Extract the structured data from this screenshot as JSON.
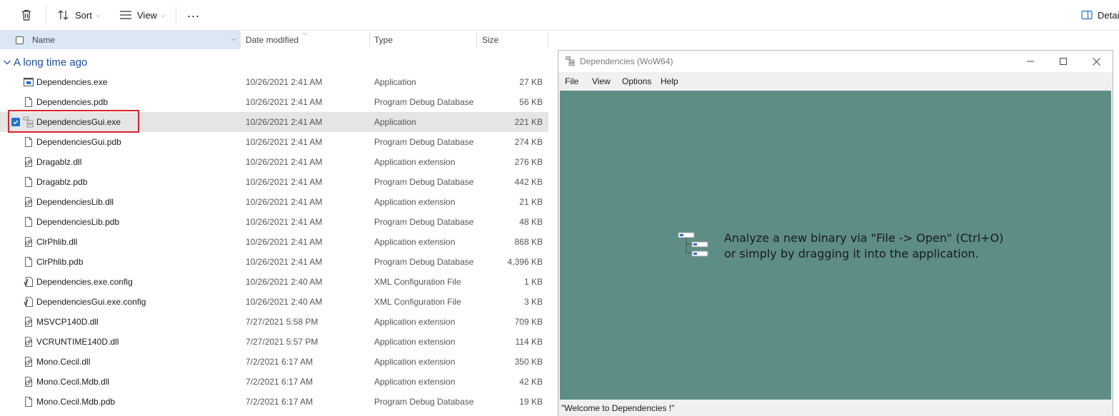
{
  "toolbar": {
    "delete_icon": "trash-icon",
    "sort_label": "Sort",
    "view_label": "View",
    "more_label": "...",
    "details_label": "Detai"
  },
  "columns": {
    "name": "Name",
    "date": "Date modified",
    "type": "Type",
    "size": "Size"
  },
  "group": {
    "label": "A long time ago"
  },
  "files": [
    {
      "name": "Dependencies.exe",
      "date": "10/26/2021 2:41 AM",
      "type": "Application",
      "size": "27 KB",
      "icon": "exe-icon"
    },
    {
      "name": "Dependencies.pdb",
      "date": "10/26/2021 2:41 AM",
      "type": "Program Debug Database",
      "size": "56 KB",
      "icon": "file-icon"
    },
    {
      "name": "DependenciesGui.exe",
      "date": "10/26/2021 2:41 AM",
      "type": "Application",
      "size": "221 KB",
      "icon": "app-icon",
      "selected": true
    },
    {
      "name": "DependenciesGui.pdb",
      "date": "10/26/2021 2:41 AM",
      "type": "Program Debug Database",
      "size": "274 KB",
      "icon": "file-icon"
    },
    {
      "name": "Dragablz.dll",
      "date": "10/26/2021 2:41 AM",
      "type": "Application extension",
      "size": "276 KB",
      "icon": "dll-icon"
    },
    {
      "name": "Dragablz.pdb",
      "date": "10/26/2021 2:41 AM",
      "type": "Program Debug Database",
      "size": "442 KB",
      "icon": "file-icon"
    },
    {
      "name": "DependenciesLib.dll",
      "date": "10/26/2021 2:41 AM",
      "type": "Application extension",
      "size": "21 KB",
      "icon": "dll-icon"
    },
    {
      "name": "DependenciesLib.pdb",
      "date": "10/26/2021 2:41 AM",
      "type": "Program Debug Database",
      "size": "48 KB",
      "icon": "file-icon"
    },
    {
      "name": "ClrPhlib.dll",
      "date": "10/26/2021 2:41 AM",
      "type": "Application extension",
      "size": "868 KB",
      "icon": "dll-icon"
    },
    {
      "name": "ClrPhlib.pdb",
      "date": "10/26/2021 2:41 AM",
      "type": "Program Debug Database",
      "size": "4,396 KB",
      "icon": "file-icon"
    },
    {
      "name": "Dependencies.exe.config",
      "date": "10/26/2021 2:40 AM",
      "type": "XML Configuration File",
      "size": "1 KB",
      "icon": "config-icon"
    },
    {
      "name": "DependenciesGui.exe.config",
      "date": "10/26/2021 2:40 AM",
      "type": "XML Configuration File",
      "size": "3 KB",
      "icon": "config-icon"
    },
    {
      "name": "MSVCP140D.dll",
      "date": "7/27/2021 5:58 PM",
      "type": "Application extension",
      "size": "709 KB",
      "icon": "dll-icon"
    },
    {
      "name": "VCRUNTIME140D.dll",
      "date": "7/27/2021 5:57 PM",
      "type": "Application extension",
      "size": "114 KB",
      "icon": "dll-icon"
    },
    {
      "name": "Mono.Cecil.dll",
      "date": "7/2/2021 6:17 AM",
      "type": "Application extension",
      "size": "350 KB",
      "icon": "dll-icon"
    },
    {
      "name": "Mono.Cecil.Mdb.dll",
      "date": "7/2/2021 6:17 AM",
      "type": "Application extension",
      "size": "42 KB",
      "icon": "dll-icon"
    },
    {
      "name": "Mono.Cecil.Mdb.pdb",
      "date": "7/2/2021 6:17 AM",
      "type": "Program Debug Database",
      "size": "19 KB",
      "icon": "file-icon"
    }
  ],
  "dependencies_window": {
    "title": "Dependencies (WoW64)",
    "menu": [
      "File",
      "View",
      "Options",
      "Help"
    ],
    "message_line1": "Analyze a new binary via \"File -> Open\" (Ctrl+O)",
    "message_line2": "or simply by dragging it into the application.",
    "status": "\"Welcome to Dependencies !\"",
    "body_color": "#5e8d86"
  },
  "colors": {
    "selection": "#e5e5e5",
    "accent": "#1f6fd0",
    "highlight_box": "#d9252a",
    "group_text": "#1a4f9c"
  }
}
